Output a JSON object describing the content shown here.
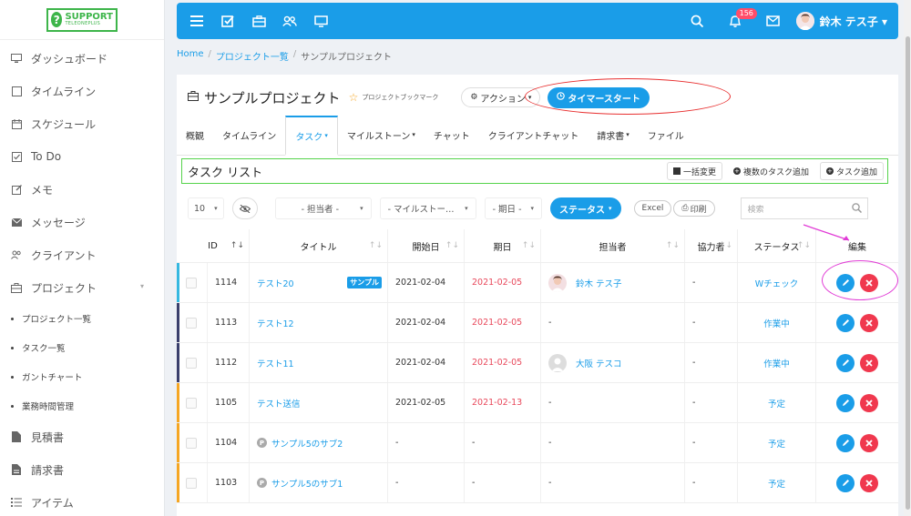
{
  "logo": {
    "main": "SUPPORT",
    "sub": "TELEONEPLUS"
  },
  "sidebar": {
    "items": [
      {
        "label": "ダッシュボード",
        "icon": "monitor-icon"
      },
      {
        "label": "タイムライン",
        "icon": "square-icon"
      },
      {
        "label": "スケジュール",
        "icon": "calendar-icon"
      },
      {
        "label": "To Do",
        "icon": "check-square-icon"
      },
      {
        "label": "メモ",
        "icon": "edit-icon"
      },
      {
        "label": "メッセージ",
        "icon": "envelope-icon"
      },
      {
        "label": "クライアント",
        "icon": "users-icon"
      },
      {
        "label": "プロジェクト",
        "icon": "briefcase-icon"
      }
    ],
    "subitems": [
      "プロジェクト一覧",
      "タスク一覧",
      "ガントチャート",
      "業務時間管理"
    ],
    "bottom_items": [
      {
        "label": "見積書",
        "icon": "file-icon"
      },
      {
        "label": "請求書",
        "icon": "file-text-icon"
      },
      {
        "label": "アイテム",
        "icon": "list-icon"
      }
    ]
  },
  "topbar": {
    "notif_count": "156",
    "user_name": "鈴木 テス子"
  },
  "breadcrumb": {
    "home": "Home",
    "list": "プロジェクト一覧",
    "current": "サンプルプロジェクト"
  },
  "project": {
    "title": "サンプルプロジェクト",
    "bookmark": "プロジェクトブックマーク",
    "action": "アクション",
    "timer": "タイマースタート"
  },
  "tabs": [
    "概観",
    "タイムライン",
    "タスク",
    "マイルストーン",
    "チャット",
    "クライアントチャット",
    "請求書",
    "ファイル"
  ],
  "tasklist": {
    "title": "タスク リスト",
    "bulk": "一括変更",
    "multi_add": "複数のタスク追加",
    "add": "タスク追加"
  },
  "filters": {
    "page_size": "10",
    "assignee": "- 担当者 -",
    "milestone": "- マイルストー…",
    "deadline": "- 期日 -",
    "status": "ステータス",
    "excel": "Excel",
    "print": "印刷",
    "search_placeholder": "検索"
  },
  "table": {
    "headers": [
      "ID",
      "タイトル",
      "開始日",
      "期日",
      "担当者",
      "協力者",
      "ステータス",
      "編集"
    ],
    "rows": [
      {
        "id": "1114",
        "title": "テスト20",
        "tag": "サンプル",
        "start": "2021-02-04",
        "due": "2021-02-05",
        "assignee": "鈴木 テス子",
        "collab": "-",
        "status": "Wチェック",
        "strip": "#35b8e0"
      },
      {
        "id": "1113",
        "title": "テスト12",
        "start": "2021-02-04",
        "due": "2021-02-05",
        "assignee": "-",
        "collab": "-",
        "status": "作業中",
        "strip": "#3a3f6b"
      },
      {
        "id": "1112",
        "title": "テスト11",
        "start": "2021-02-04",
        "due": "2021-02-05",
        "assignee": "大阪 テスコ",
        "collab": "-",
        "status": "作業中",
        "strip": "#3a3f6b"
      },
      {
        "id": "1105",
        "title": "テスト送信",
        "start": "2021-02-05",
        "due": "2021-02-13",
        "assignee": "-",
        "collab": "-",
        "status": "予定",
        "strip": "#f5a623"
      },
      {
        "id": "1104",
        "title": "サンプル5のサブ2",
        "start": "-",
        "due": "-",
        "assignee": "-",
        "collab": "-",
        "status": "予定",
        "strip": "#f5a623"
      },
      {
        "id": "1103",
        "title": "サンプル5のサブ1",
        "start": "-",
        "due": "-",
        "assignee": "-",
        "collab": "-",
        "status": "予定",
        "strip": "#f5a623"
      }
    ]
  }
}
